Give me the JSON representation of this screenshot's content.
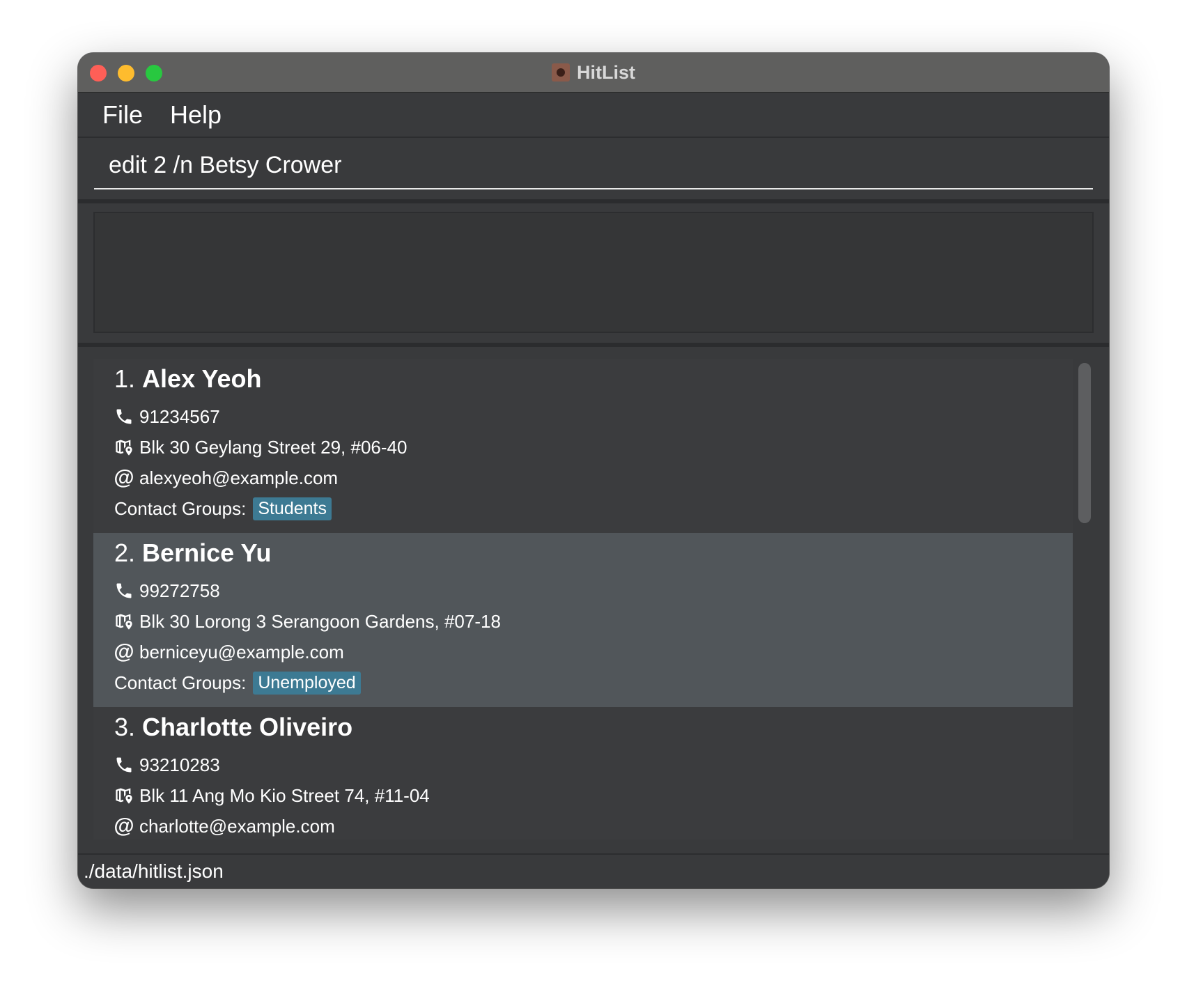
{
  "window": {
    "title": "HitList"
  },
  "menu": {
    "file_label": "File",
    "help_label": "Help"
  },
  "command": {
    "value": "edit 2 /n Betsy Crower"
  },
  "result": {
    "text": ""
  },
  "persons": [
    {
      "index": "1.",
      "name": "Alex Yeoh",
      "phone": "91234567",
      "address": "Blk 30 Geylang Street 29, #06-40",
      "email": "alexyeoh@example.com",
      "groups_label": "Contact Groups:",
      "groups": [
        "Students"
      ]
    },
    {
      "index": "2.",
      "name": "Bernice Yu",
      "phone": "99272758",
      "address": "Blk 30 Lorong 3 Serangoon Gardens, #07-18",
      "email": "berniceyu@example.com",
      "groups_label": "Contact Groups:",
      "groups": [
        "Unemployed"
      ]
    },
    {
      "index": "3.",
      "name": "Charlotte Oliveiro",
      "phone": "93210283",
      "address": "Blk 11 Ang Mo Kio Street 74, #11-04",
      "email": "charlotte@example.com"
    }
  ],
  "status": {
    "file_path": "./data/hitlist.json"
  },
  "colors": {
    "tag_background": "#3d7a93",
    "selected_row": "#51565a",
    "window_background": "#3b3c3e"
  },
  "icons": {
    "phone": "phone-icon",
    "address": "map-pin-icon",
    "email": "at-icon"
  }
}
